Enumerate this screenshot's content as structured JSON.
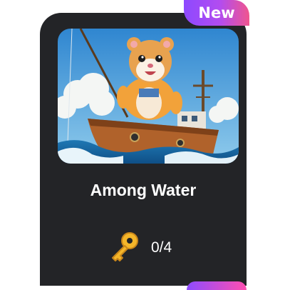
{
  "card": {
    "badge": "New",
    "title": "Among Water",
    "image_subject": "hamster-fishing-on-boat",
    "keys": "0/4",
    "key_icon": "key-icon"
  },
  "colors": {
    "card_background": "#232427",
    "badge_gradient_start": "#8d49ff",
    "badge_gradient_end": "#f0558e",
    "text": "#ffffff"
  }
}
